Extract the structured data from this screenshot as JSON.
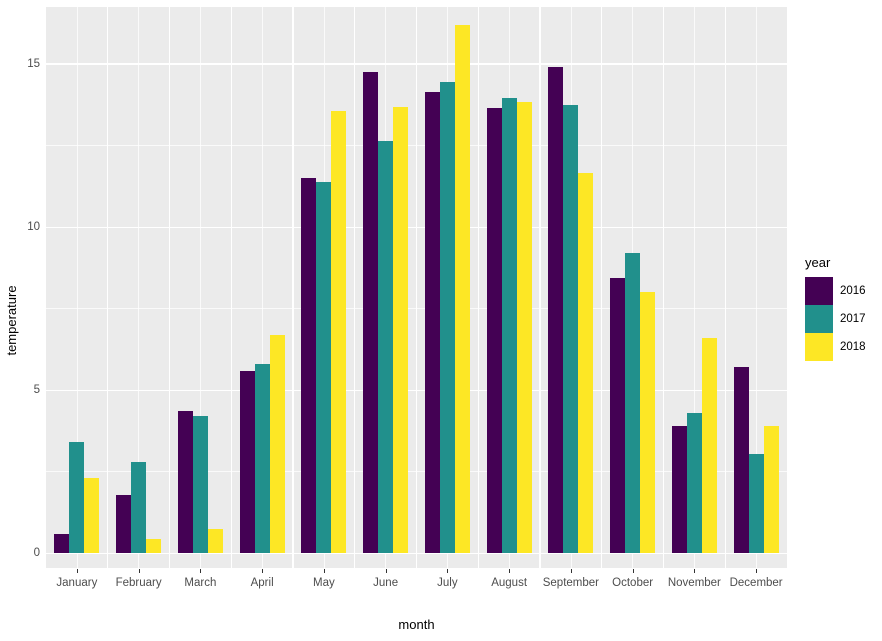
{
  "chart_data": {
    "type": "bar",
    "title": "",
    "xlabel": "month",
    "ylabel": "temperature",
    "categories": [
      "January",
      "February",
      "March",
      "April",
      "May",
      "June",
      "July",
      "August",
      "September",
      "October",
      "November",
      "December"
    ],
    "series": [
      {
        "name": "2016",
        "color": "#440154",
        "values": [
          0.6,
          1.8,
          4.35,
          5.6,
          11.5,
          14.75,
          14.15,
          13.65,
          14.9,
          8.45,
          3.9,
          5.7
        ]
      },
      {
        "name": "2017",
        "color": "#21908C",
        "values": [
          3.4,
          2.8,
          4.2,
          5.8,
          11.4,
          12.65,
          14.45,
          13.95,
          13.75,
          9.2,
          4.3,
          3.05
        ]
      },
      {
        "name": "2018",
        "color": "#FDE725",
        "values": [
          2.3,
          0.45,
          0.75,
          6.7,
          13.55,
          13.7,
          16.2,
          13.85,
          11.65,
          8.0,
          6.6,
          3.9
        ]
      }
    ],
    "ylim": [
      -0.45,
      16.75
    ],
    "y_major_ticks": [
      0,
      5,
      10,
      15
    ],
    "y_minor_ticks": [
      2.5,
      7.5,
      12.5
    ],
    "y_tick_labels": [
      "0",
      "5",
      "10",
      "15"
    ],
    "grid": true,
    "legend_position": "right",
    "legend_title": "year",
    "panel_background": "#ebebeb",
    "grid_color": "#ffffff",
    "plot_background": "#ffffff"
  },
  "axes": {
    "x_title": "month",
    "y_title": "temperature"
  },
  "legend": {
    "title": "year",
    "entries": [
      {
        "label": "2016",
        "color": "#440154"
      },
      {
        "label": "2017",
        "color": "#21908C"
      },
      {
        "label": "2018",
        "color": "#FDE725"
      }
    ]
  }
}
